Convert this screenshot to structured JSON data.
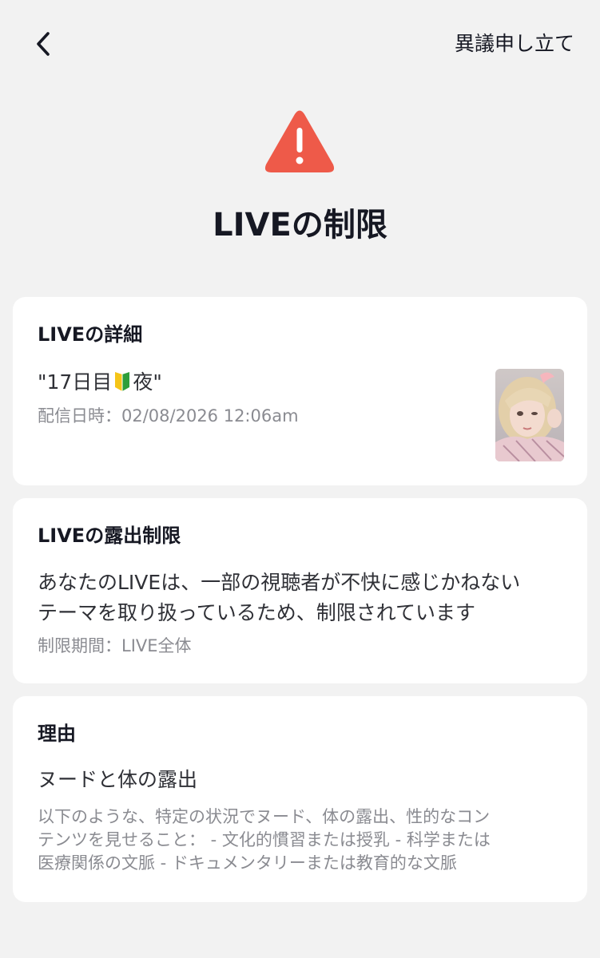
{
  "header": {
    "back_icon": "chevron-left-icon",
    "appeal_label": "異議申し立て"
  },
  "hero": {
    "icon": "warning-triangle-icon",
    "icon_color": "#ee5a49",
    "title": "LIVEの制限"
  },
  "details_card": {
    "title": "LIVEの詳細",
    "stream_title_prefix": "\"17日目",
    "stream_title_suffix": "夜\"",
    "emoji_icon": "beginner-mark-icon",
    "stream_date": "配信日時：02/08/2026 12:06am",
    "thumbnail": "stream-thumbnail"
  },
  "exposure_card": {
    "title": "LIVEの露出制限",
    "line1": "あなたのLIVEは、一部の視聴者が不快に感じかねない",
    "line2": "テーマを取り扱っているため、制限されています",
    "period": "制限期間：LIVE全体"
  },
  "reason_card": {
    "title": "理由",
    "reason": "ヌードと体の露出",
    "desc_line1": "以下のような、特定の状況でヌード、体の露出、性的なコン",
    "desc_line2": "テンツを見せること： - 文化的慣習または授乳 - 科学または",
    "desc_line3": "医療関係の文脈 - ドキュメンタリーまたは教育的な文脈"
  }
}
